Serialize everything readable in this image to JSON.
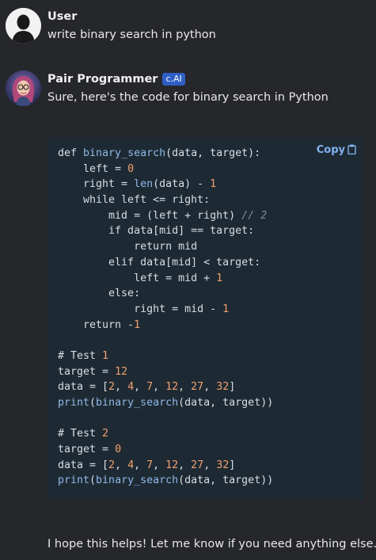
{
  "messages": {
    "user": {
      "name": "User",
      "text": "write binary search in python"
    },
    "bot": {
      "name": "Pair Programmer",
      "badge": "c.AI",
      "intro": "Sure, here's the code for binary search in Python",
      "outro": "I hope this helps! Let me know if you need anything else."
    }
  },
  "code_block": {
    "copy_label": "Copy",
    "lines": [
      "def binary_search(data, target):",
      "    left = 0",
      "    right = len(data) - 1",
      "    while left <= right:",
      "        mid = (left + right) // 2",
      "        if data[mid] == target:",
      "            return mid",
      "        elif data[mid] < target:",
      "            left = mid + 1",
      "        else:",
      "            right = mid - 1",
      "    return -1",
      "",
      "# Test 1",
      "target = 12",
      "data = [2, 4, 7, 12, 27, 32]",
      "print(binary_search(data, target))",
      "",
      "# Test 2",
      "target = 0",
      "data = [2, 4, 7, 12, 27, 32]",
      "print(binary_search(data, target))"
    ]
  },
  "colors": {
    "background": "#26272b",
    "code_background": "#1e2a33",
    "badge": "#2f5ec4",
    "copy": "#7fb2f0",
    "number": "#f0a070",
    "function": "#8fb8e8"
  }
}
